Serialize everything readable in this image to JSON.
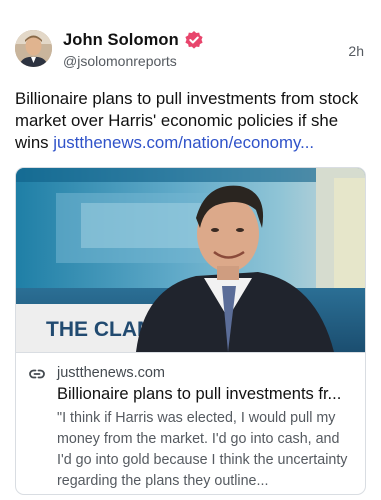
{
  "author": {
    "display_name": "John Solomon",
    "handle": "@jsolomonreports",
    "verified_icon": "verified-badge-icon",
    "verified_color": "#e8456c"
  },
  "post": {
    "time": "2h",
    "text": "Billionaire plans to pull investments from stock market over Harris' economic policies if she wins ",
    "link_text": "justthenews.com/nation/economy..."
  },
  "card": {
    "image_caption_text": "THE CLAM",
    "domain": "justthenews.com",
    "title": "Billionaire plans to pull investments fr...",
    "description": "\"I think if Harris was elected, I would pull my money from the market. I'd go into cash, and I'd go into gold because I think the uncertainty regarding the plans they outline..."
  },
  "colors": {
    "link": "#2f52c9",
    "text": "#111111",
    "muted": "#555a60"
  }
}
